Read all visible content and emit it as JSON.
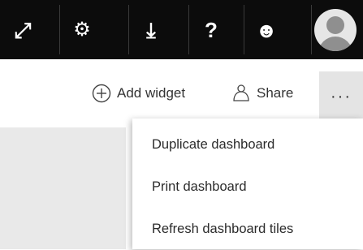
{
  "topbar": {
    "buttons": [
      {
        "name": "expand",
        "icon": "expand-diagonal-arrows-icon",
        "glyph": "⤢"
      },
      {
        "name": "settings",
        "icon": "gear-icon",
        "glyph": "⚙"
      },
      {
        "name": "download",
        "icon": "download-arrow-icon",
        "glyph": "⤓"
      },
      {
        "name": "help",
        "icon": "question-mark-icon",
        "glyph": "?"
      },
      {
        "name": "feedback",
        "icon": "smiley-face-icon",
        "glyph": "☻"
      }
    ],
    "avatar_icon": "user-avatar-icon"
  },
  "commandbar": {
    "add_widget_label": "Add widget",
    "add_widget_icon": "plus-circle-icon",
    "share_label": "Share",
    "share_icon": "share-people-icon",
    "more_label": "···",
    "more_icon": "ellipsis-icon"
  },
  "menu": {
    "items": [
      {
        "label": "Duplicate dashboard"
      },
      {
        "label": "Print dashboard"
      },
      {
        "label": "Refresh dashboard tiles"
      }
    ]
  },
  "colors": {
    "topbar_bg": "#0c0c0c",
    "more_button_bg": "#e4e4e4",
    "text": "#333333"
  }
}
